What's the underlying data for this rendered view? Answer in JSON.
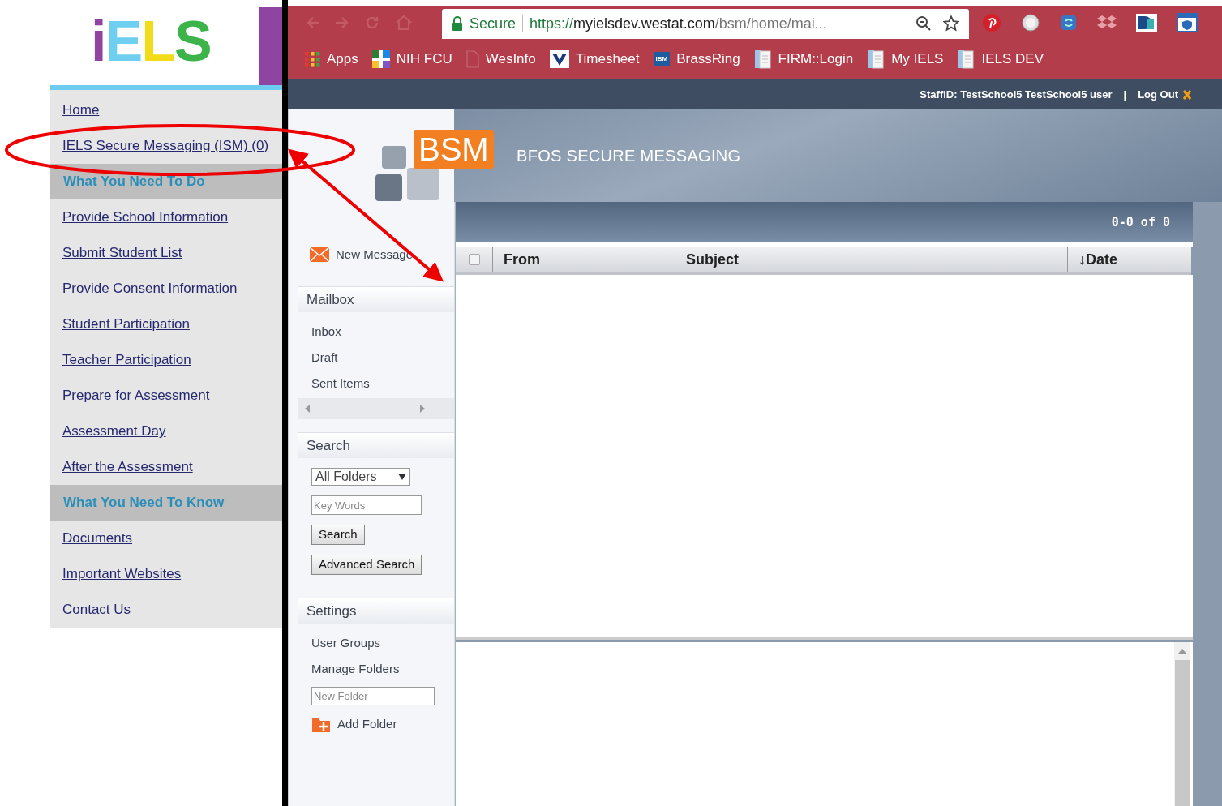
{
  "logo": {
    "letters": [
      {
        "text": "i",
        "color": "#8e44a0"
      },
      {
        "text": "E",
        "color": "#6ecff0"
      },
      {
        "text": "L",
        "color": "#f2dc1a"
      },
      {
        "text": "S",
        "color": "#3cb449"
      }
    ]
  },
  "nav": [
    {
      "kind": "link",
      "label": "Home"
    },
    {
      "kind": "link",
      "label": "IELS Secure Messaging (ISM) (0)"
    },
    {
      "kind": "heading",
      "label": "What You Need To Do"
    },
    {
      "kind": "link",
      "label": "Provide School Information"
    },
    {
      "kind": "link",
      "label": "Submit Student List"
    },
    {
      "kind": "link",
      "label": "Provide Consent Information"
    },
    {
      "kind": "link",
      "label": "Student Participation"
    },
    {
      "kind": "link",
      "label": "Teacher Participation"
    },
    {
      "kind": "link",
      "label": "Prepare for Assessment"
    },
    {
      "kind": "link",
      "label": "Assessment Day"
    },
    {
      "kind": "link",
      "label": "After the Assessment"
    },
    {
      "kind": "heading",
      "label": "What You Need To Know"
    },
    {
      "kind": "link",
      "label": "Documents"
    },
    {
      "kind": "link",
      "label": "Important Websites"
    },
    {
      "kind": "link",
      "label": "Contact Us"
    }
  ],
  "browser": {
    "secure_label": "Secure",
    "url_scheme": "https://",
    "url_host": "myielsdev.westat.com",
    "url_path": "/bsm/home/mai...",
    "bookmarks": [
      {
        "kind": "grid",
        "label": "Apps"
      },
      {
        "kind": "tile",
        "label": "NIH FCU"
      },
      {
        "kind": "page",
        "label": "WesInfo"
      },
      {
        "kind": "v",
        "label": "Timesheet"
      },
      {
        "kind": "ibm",
        "label": "BrassRing",
        "icon_text": "IBM"
      },
      {
        "kind": "doc",
        "label": "FIRM::Login"
      },
      {
        "kind": "doc",
        "label": "My IELS"
      },
      {
        "kind": "doc",
        "label": "IELS DEV"
      }
    ]
  },
  "user_bar": {
    "user": "StaffID: TestSchool5  TestSchool5 user",
    "separator": "|",
    "logout": "Log Out"
  },
  "app": {
    "logo_text": "BSM",
    "title": "BFOS SECURE MESSAGING",
    "pager": "0-0 of 0"
  },
  "sidebar": {
    "new_message": "New Message",
    "mailbox": {
      "title": "Mailbox",
      "items": [
        "Inbox",
        "Draft",
        "Sent Items"
      ]
    },
    "search": {
      "title": "Search",
      "folder_select": "All Folders",
      "keywords": {
        "placeholder": "Key Words"
      },
      "search_button": "Search",
      "advanced_button": "Advanced Search"
    },
    "settings": {
      "title": "Settings",
      "items": [
        "User Groups",
        "Manage Folders"
      ],
      "new_folder": {
        "placeholder": "New Folder"
      },
      "add_folder": "Add Folder"
    }
  },
  "table": {
    "select_all": {
      "checked": false
    },
    "columns": [
      {
        "kind": "text",
        "label": "From"
      },
      {
        "kind": "text",
        "label": "Subject"
      },
      {
        "kind": "spacer"
      },
      {
        "kind": "text",
        "label": "↓Date"
      }
    ]
  }
}
